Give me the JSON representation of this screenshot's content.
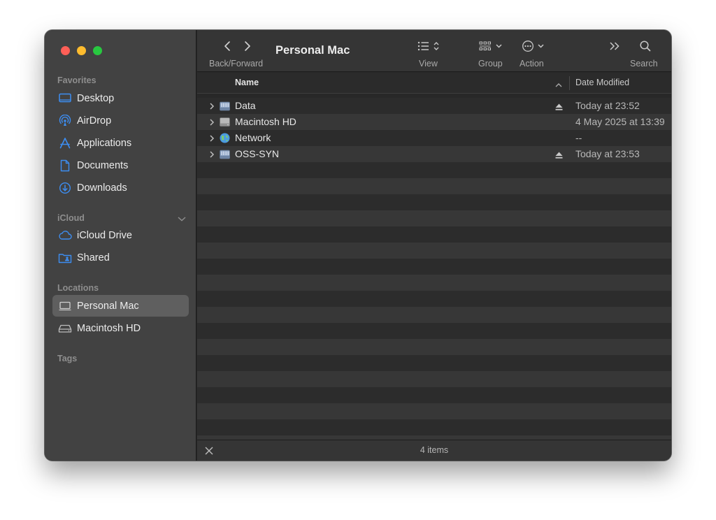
{
  "window": {
    "title": "Personal Mac"
  },
  "toolbar": {
    "back_forward_label": "Back/Forward",
    "view_label": "View",
    "group_label": "Group",
    "action_label": "Action",
    "search_label": "Search"
  },
  "sidebar": {
    "favorites_title": "Favorites",
    "favorites": [
      {
        "label": "Desktop",
        "icon": "desktop-icon"
      },
      {
        "label": "AirDrop",
        "icon": "airdrop-icon"
      },
      {
        "label": "Applications",
        "icon": "applications-icon"
      },
      {
        "label": "Documents",
        "icon": "document-icon"
      },
      {
        "label": "Downloads",
        "icon": "downloads-icon"
      }
    ],
    "icloud_title": "iCloud",
    "icloud": [
      {
        "label": "iCloud Drive",
        "icon": "cloud-icon"
      },
      {
        "label": "Shared",
        "icon": "shared-folder-icon"
      }
    ],
    "locations_title": "Locations",
    "locations": [
      {
        "label": "Personal Mac",
        "icon": "laptop-icon",
        "selected": true
      },
      {
        "label": "Macintosh HD",
        "icon": "hard-drive-icon",
        "selected": false
      }
    ],
    "tags_title": "Tags"
  },
  "columns": {
    "name": "Name",
    "date_modified": "Date Modified"
  },
  "files": [
    {
      "name": "Data",
      "date": "Today at 23:52",
      "icon": "network-drive-icon",
      "ejectable": true
    },
    {
      "name": "Macintosh HD",
      "date": "4 May 2025 at 13:39",
      "icon": "internal-disk-icon",
      "ejectable": false
    },
    {
      "name": "Network",
      "date": "--",
      "icon": "network-globe-icon",
      "ejectable": false
    },
    {
      "name": "OSS-SYN",
      "date": "Today at 23:53",
      "icon": "network-drive-icon",
      "ejectable": true
    }
  ],
  "status": {
    "item_count": "4 items"
  },
  "colors": {
    "sidebar_accent": "#3d8ef2",
    "selection": "#5f5f5f",
    "traffic_red": "#ff5f57",
    "traffic_yellow": "#febc2e",
    "traffic_green": "#28c840"
  }
}
